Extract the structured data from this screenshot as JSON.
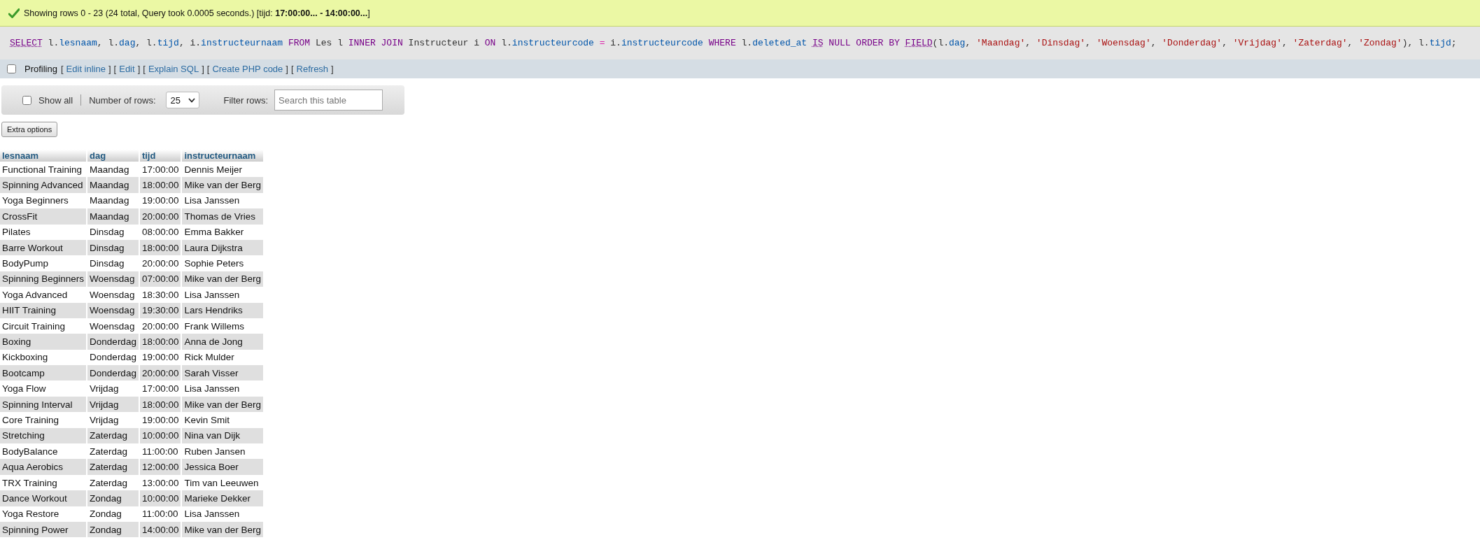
{
  "message": {
    "text": "Showing rows 0 - 23 (24 total, Query took 0.0005 seconds.) [tijd: **17:00:00... - 14:00:00...**]"
  },
  "sql": [
    {
      "text": "SELECT",
      "kind": "keyword-link"
    },
    {
      "text": " l.",
      "kind": "plain"
    },
    {
      "text": "lesnaam",
      "kind": "identifier"
    },
    {
      "text": ", l.",
      "kind": "plain"
    },
    {
      "text": "dag",
      "kind": "identifier"
    },
    {
      "text": ", l.",
      "kind": "plain"
    },
    {
      "text": "tijd",
      "kind": "identifier"
    },
    {
      "text": ", i.",
      "kind": "plain"
    },
    {
      "text": "instructeurnaam ",
      "kind": "identifier"
    },
    {
      "text": "FROM",
      "kind": "keyword"
    },
    {
      "text": " Les l ",
      "kind": "plain"
    },
    {
      "text": "INNER JOIN",
      "kind": "keyword"
    },
    {
      "text": " Instructeur i ",
      "kind": "plain"
    },
    {
      "text": "ON",
      "kind": "keyword"
    },
    {
      "text": " l.",
      "kind": "plain"
    },
    {
      "text": "instructeurcode ",
      "kind": "identifier"
    },
    {
      "text": "=",
      "kind": "operator"
    },
    {
      "text": " i.",
      "kind": "plain"
    },
    {
      "text": "instructeurcode ",
      "kind": "identifier"
    },
    {
      "text": "WHERE",
      "kind": "keyword"
    },
    {
      "text": " l.",
      "kind": "plain"
    },
    {
      "text": "deleted_at ",
      "kind": "identifier"
    },
    {
      "text": "IS",
      "kind": "keyword-link"
    },
    {
      "text": " NULL ORDER BY ",
      "kind": "keyword"
    },
    {
      "text": "FIELD",
      "kind": "keyword-link"
    },
    {
      "text": "(l.",
      "kind": "plain"
    },
    {
      "text": "dag",
      "kind": "identifier"
    },
    {
      "text": ", ",
      "kind": "plain"
    },
    {
      "text": "'Maandag'",
      "kind": "string"
    },
    {
      "text": ", ",
      "kind": "plain"
    },
    {
      "text": "'Dinsdag'",
      "kind": "string"
    },
    {
      "text": ", ",
      "kind": "plain"
    },
    {
      "text": "'Woensdag'",
      "kind": "string"
    },
    {
      "text": ", ",
      "kind": "plain"
    },
    {
      "text": "'Donderdag'",
      "kind": "string"
    },
    {
      "text": ", ",
      "kind": "plain"
    },
    {
      "text": "'Vrijdag'",
      "kind": "string"
    },
    {
      "text": ", ",
      "kind": "plain"
    },
    {
      "text": "'Zaterdag'",
      "kind": "string"
    },
    {
      "text": ", ",
      "kind": "plain"
    },
    {
      "text": "'Zondag'",
      "kind": "string"
    },
    {
      "text": "), l.",
      "kind": "plain"
    },
    {
      "text": "tijd",
      "kind": "identifier"
    },
    {
      "text": ";",
      "kind": "plain"
    }
  ],
  "profiling": {
    "label": "Profiling",
    "checked": false,
    "links": [
      {
        "open": "[",
        "label": "Edit inline",
        "close": "]"
      },
      {
        "open": "[",
        "label": "Edit",
        "close": "]"
      },
      {
        "open": "[",
        "label": "Explain SQL",
        "close": "]"
      },
      {
        "open": "[",
        "label": "Create PHP code",
        "close": "]"
      },
      {
        "open": "[",
        "label": "Refresh",
        "close": "]"
      }
    ]
  },
  "toolbar": {
    "show_all": {
      "label": "Show all",
      "checked": false
    },
    "rows_label": "Number of rows:",
    "rows_value": "25",
    "filter_label": "Filter rows:",
    "filter_placeholder": "Search this table"
  },
  "extra_options": "Extra options",
  "table": {
    "columns": [
      "lesnaam",
      "dag",
      "tijd",
      "instructeurnaam"
    ],
    "rows": [
      [
        "Functional Training",
        "Maandag",
        "17:00:00",
        "Dennis Meijer"
      ],
      [
        "Spinning Advanced",
        "Maandag",
        "18:00:00",
        "Mike van der Berg"
      ],
      [
        "Yoga Beginners",
        "Maandag",
        "19:00:00",
        "Lisa Janssen"
      ],
      [
        "CrossFit",
        "Maandag",
        "20:00:00",
        "Thomas de Vries"
      ],
      [
        "Pilates",
        "Dinsdag",
        "08:00:00",
        "Emma Bakker"
      ],
      [
        "Barre Workout",
        "Dinsdag",
        "18:00:00",
        "Laura Dijkstra"
      ],
      [
        "BodyPump",
        "Dinsdag",
        "20:00:00",
        "Sophie Peters"
      ],
      [
        "Spinning Beginners",
        "Woensdag",
        "07:00:00",
        "Mike van der Berg"
      ],
      [
        "Yoga Advanced",
        "Woensdag",
        "18:30:00",
        "Lisa Janssen"
      ],
      [
        "HIIT Training",
        "Woensdag",
        "19:30:00",
        "Lars Hendriks"
      ],
      [
        "Circuit Training",
        "Woensdag",
        "20:00:00",
        "Frank Willems"
      ],
      [
        "Boxing",
        "Donderdag",
        "18:00:00",
        "Anna de Jong"
      ],
      [
        "Kickboxing",
        "Donderdag",
        "19:00:00",
        "Rick Mulder"
      ],
      [
        "Bootcamp",
        "Donderdag",
        "20:00:00",
        "Sarah Visser"
      ],
      [
        "Yoga Flow",
        "Vrijdag",
        "17:00:00",
        "Lisa Janssen"
      ],
      [
        "Spinning Interval",
        "Vrijdag",
        "18:00:00",
        "Mike van der Berg"
      ],
      [
        "Core Training",
        "Vrijdag",
        "19:00:00",
        "Kevin Smit"
      ],
      [
        "Stretching",
        "Zaterdag",
        "10:00:00",
        "Nina van Dijk"
      ],
      [
        "BodyBalance",
        "Zaterdag",
        "11:00:00",
        "Ruben Jansen"
      ],
      [
        "Aqua Aerobics",
        "Zaterdag",
        "12:00:00",
        "Jessica Boer"
      ],
      [
        "TRX Training",
        "Zaterdag",
        "13:00:00",
        "Tim van Leeuwen"
      ],
      [
        "Dance Workout",
        "Zondag",
        "10:00:00",
        "Marieke Dekker"
      ],
      [
        "Yoga Restore",
        "Zondag",
        "11:00:00",
        "Lisa Janssen"
      ],
      [
        "Spinning Power",
        "Zondag",
        "14:00:00",
        "Mike van der Berg"
      ]
    ]
  }
}
